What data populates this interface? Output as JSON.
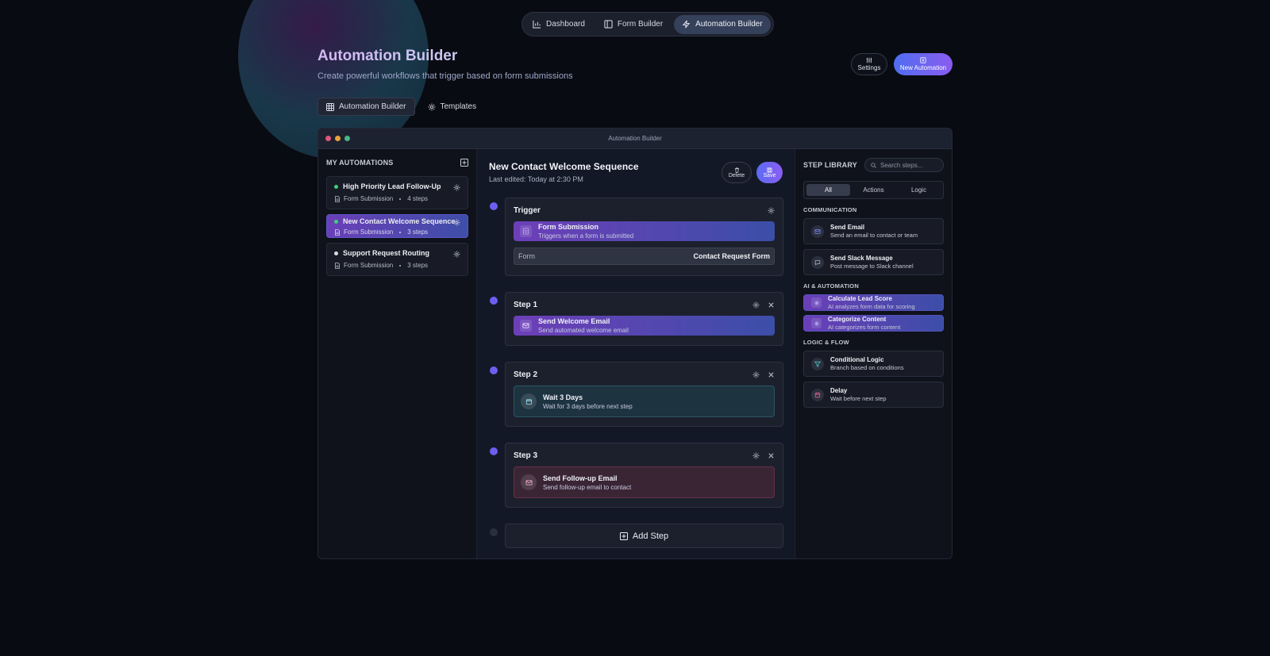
{
  "nav": {
    "items": [
      {
        "label": "Dashboard",
        "icon": "bar-chart-icon"
      },
      {
        "label": "Form Builder",
        "icon": "layout-icon"
      },
      {
        "label": "Automation Builder",
        "icon": "lightning-icon",
        "active": true
      }
    ]
  },
  "header": {
    "title": "Automation Builder",
    "subtitle": "Create powerful workflows that trigger based on form submissions",
    "settings_label": "Settings",
    "new_label": "New Automation"
  },
  "tabs": [
    {
      "label": "Automation Builder",
      "icon": "grid-icon",
      "active": true
    },
    {
      "label": "Templates",
      "icon": "gear-icon"
    }
  ],
  "window": {
    "title": "Automation Builder",
    "dot_colors": [
      "#e0567a",
      "#e8a23c",
      "#4bb58a"
    ]
  },
  "left": {
    "title": "MY AUTOMATIONS",
    "items": [
      {
        "name": "High Priority Lead Follow-Up",
        "trigger": "Form Submission",
        "steps": "4 steps",
        "status_color": "#3ed07a"
      },
      {
        "name": "New Contact Welcome Sequence",
        "trigger": "Form Submission",
        "steps": "3 steps",
        "status_color": "#3ed07a",
        "active": true
      },
      {
        "name": "Support Request Routing",
        "trigger": "Form Submission",
        "steps": "3 steps",
        "status_color": "#d8dbe4"
      }
    ]
  },
  "mid": {
    "title": "New Contact Welcome Sequence",
    "subtitle": "Last edited: Today at 2:30 PM",
    "delete_label": "Delete",
    "save_label": "Save",
    "trigger": {
      "title": "Trigger",
      "action_name": "Form Submission",
      "action_desc": "Triggers when a form is submitted",
      "form_label": "Form",
      "form_value": "Contact Request Form"
    },
    "steps": [
      {
        "title": "Step 1",
        "name": "Send Welcome Email",
        "desc": "Send automated welcome email"
      },
      {
        "title": "Step 2",
        "name": "Wait 3 Days",
        "desc": "Wait for 3 days before next step"
      },
      {
        "title": "Step 3",
        "name": "Send Follow-up Email",
        "desc": "Send follow-up email to contact"
      }
    ],
    "add_step_label": "Add Step"
  },
  "right": {
    "title": "STEP LIBRARY",
    "search_placeholder": "Search steps...",
    "filters": [
      "All",
      "Actions",
      "Logic"
    ],
    "categories": [
      {
        "title": "COMMUNICATION",
        "items": [
          {
            "name": "Send Email",
            "desc": "Send an email to contact or team"
          },
          {
            "name": "Send Slack Message",
            "desc": "Post message to Slack channel"
          }
        ]
      },
      {
        "title": "AI & AUTOMATION",
        "items": [
          {
            "name": "Calculate Lead Score",
            "desc": "AI analyzes form data for scoring"
          },
          {
            "name": "Categorize Content",
            "desc": "AI categorizes form content"
          }
        ]
      },
      {
        "title": "LOGIC & FLOW",
        "items": [
          {
            "name": "Conditional Logic",
            "desc": "Branch based on conditions"
          },
          {
            "name": "Delay",
            "desc": "Wait before next step"
          }
        ]
      }
    ]
  }
}
